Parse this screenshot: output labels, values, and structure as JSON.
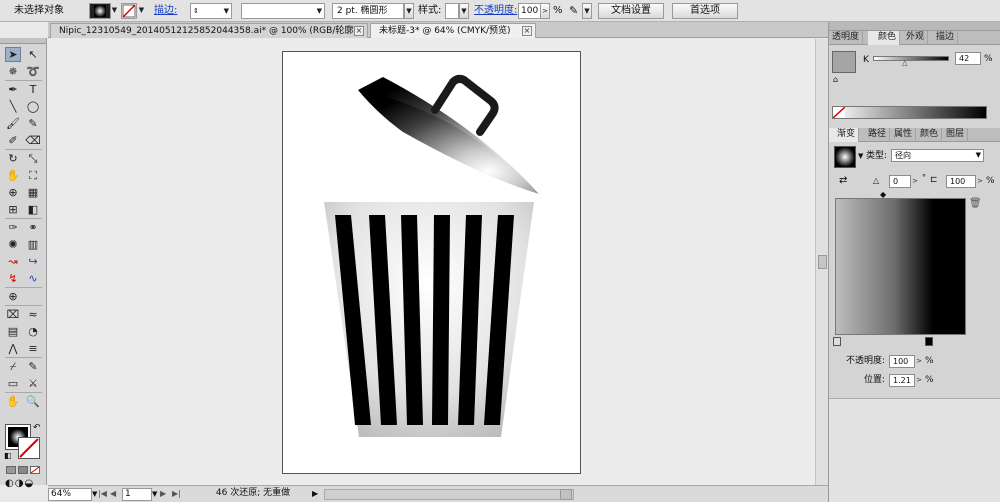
{
  "control_bar": {
    "selection_status": "未选择对象",
    "stroke_label": "描边:",
    "stroke_weight": "",
    "brush_value": "",
    "brush_profile": "2 pt. 椭圆形",
    "style_label": "样式:",
    "opacity_label": "不透明度:",
    "opacity_value": "100",
    "opacity_unit": "%",
    "document_setup_button": "文档设置",
    "preferences_button": "首选项"
  },
  "tabs": [
    {
      "title": "Nipic_12310549_20140512125852044358.ai* @ 100% (RGB/轮廓)",
      "active": false
    },
    {
      "title": "未标题-3* @ 64% (CMYK/预览)",
      "active": true
    }
  ],
  "tools": {
    "rows": [
      [
        "selection-tool",
        "direct-selection-tool"
      ],
      [
        "magic-wand-tool",
        "lasso-tool"
      ],
      [
        "pen-tool",
        "type-tool"
      ],
      [
        "line-segment-tool",
        "ellipse-tool"
      ],
      [
        "paintbrush-tool",
        "pencil-tool"
      ],
      [
        "blob-brush-tool",
        "eraser-tool"
      ],
      [
        "rotate-tool",
        "scale-tool"
      ],
      [
        "warp-tool",
        "free-transform-tool"
      ],
      [
        "shape-builder-tool",
        "perspective-grid-tool"
      ],
      [
        "mesh-tool",
        "gradient-tool"
      ],
      [
        "eyedropper-tool",
        "blend-tool"
      ],
      [
        "symbol-sprayer-tool",
        "column-graph-tool"
      ],
      [
        "curve-tool-a",
        "curve-tool-b"
      ],
      [
        "curve-tool-c",
        "curve-tool-d"
      ],
      [
        "globe-tool"
      ],
      [
        "envelope-tool",
        "wave-tool"
      ],
      [
        "chart-grid-tool",
        "graph-tool"
      ],
      [
        "zigzag-tool",
        "list-tool"
      ],
      [
        "slice-tool",
        "eyedropper-alt-tool"
      ],
      [
        "artboard-tool",
        "knife-tool"
      ],
      [
        "hand-tool",
        "zoom-tool"
      ]
    ],
    "colors": {
      "fill": "#000000",
      "stroke": "none"
    }
  },
  "status_bar": {
    "zoom": "64%",
    "page_number": "1",
    "history_status": "46 次还原; 无重做"
  },
  "color_panel": {
    "tabs": [
      "透明度",
      "颜色",
      "外观",
      "描边"
    ],
    "active_tab": "颜色",
    "channel_label": "K",
    "k_value": "42",
    "unit": "%"
  },
  "gradient_panel": {
    "tabs": [
      "渐变",
      "路径",
      "属性",
      "颜色",
      "图层"
    ],
    "active_tab": "渐变",
    "type_label": "类型:",
    "type_value": "径向",
    "angle_value": "0",
    "angle_unit": "°",
    "aspect_value": "100",
    "aspect_unit": "%",
    "opacity_label": "不透明度:",
    "opacity_value": "100",
    "opacity_unit": "%",
    "location_label": "位置:",
    "location_value": "1.21",
    "location_unit": "%"
  },
  "colors": {
    "ui_bg": "#e3e3e3",
    "selected_tool": "#9fb0c6",
    "link": "#1a3fc0",
    "artwork_black": "#000000"
  }
}
